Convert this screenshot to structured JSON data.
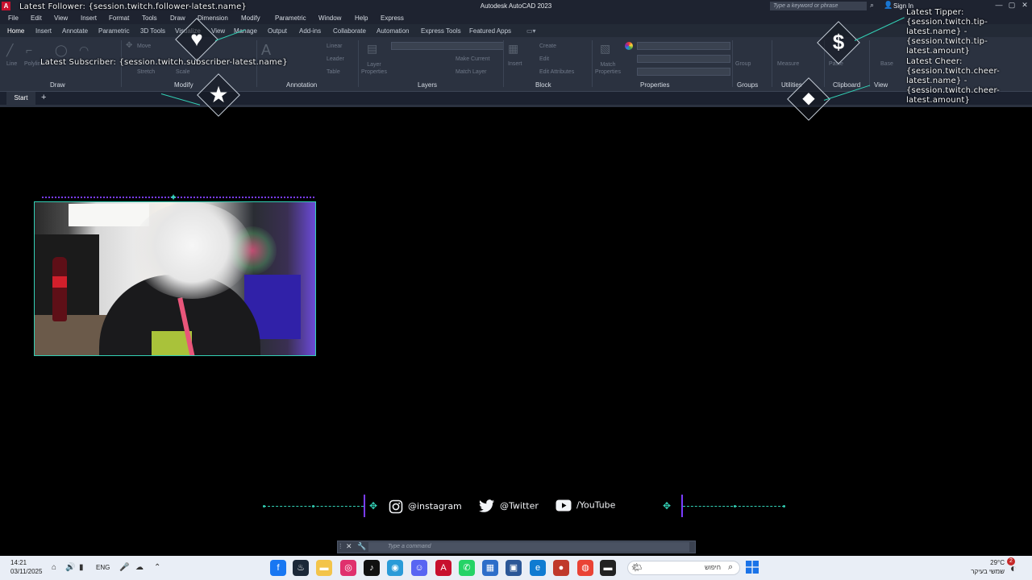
{
  "titlebar": {
    "app_title": "Autodesk AutoCAD 2023",
    "logo": "A",
    "search_placeholder": "Type a keyword or phrase",
    "sign_in": "Sign In"
  },
  "menu": [
    "File",
    "Edit",
    "View",
    "Insert",
    "Format",
    "Tools",
    "Draw",
    "Dimension",
    "Modify",
    "Parametric",
    "Window",
    "Help",
    "Express"
  ],
  "ribbon_tabs": [
    "Home",
    "Insert",
    "Annotate",
    "Parametric",
    "3D Tools",
    "Visualize",
    "View",
    "Manage",
    "Output",
    "Add-ins",
    "Collaborate",
    "Automation",
    "Express Tools",
    "Featured Apps"
  ],
  "ribbon": {
    "panels": [
      "Draw",
      "Modify",
      "Annotation",
      "Layers",
      "Block",
      "Properties",
      "Groups",
      "Utilities",
      "Clipboard",
      "View"
    ],
    "tools": {
      "line": "Line",
      "polyline": "Polyline",
      "move": "Move",
      "stretch": "Stretch",
      "scale": "Scale",
      "linear": "Linear",
      "leader": "Leader",
      "table": "Table",
      "layer_properties": "Layer Properties",
      "make_current": "Make Current",
      "match_layer": "Match Layer",
      "insert": "Insert",
      "create": "Create",
      "edit": "Edit",
      "edit_attributes": "Edit Attributes",
      "match_properties": "Match Properties",
      "group": "Group",
      "measure": "Measure",
      "paste": "Paste",
      "base": "Base"
    }
  },
  "file_tabs": {
    "start": "Start",
    "add": "+"
  },
  "overlay": {
    "latest_follower": "Latest Follower: {session.twitch.follower-latest.name}",
    "latest_subscriber": "Latest Subscriber: {session.twitch.subscriber-latest.name}",
    "latest_tipper": [
      "Latest Tipper:",
      "{session.twitch.tip-",
      "latest.name} -",
      "{session.twitch.tip-",
      "latest.amount}"
    ],
    "latest_cheer": [
      "Latest Cheer:",
      "{session.twitch.cheer-",
      "latest.name} -",
      "{session.twitch.cheer-",
      "latest.amount}"
    ],
    "socials": {
      "instagram": "@instagram",
      "twitter": "@Twitter",
      "youtube": "/YouTube"
    }
  },
  "command_line": {
    "placeholder": "Type a command"
  },
  "taskbar": {
    "time": "14:21",
    "date": "03/11/2025",
    "lang": "ENG",
    "search_label": "חיפוש",
    "weather_temp": "29°C",
    "weather_desc": "שמשי בעיקר",
    "badge": "2"
  },
  "colors": {
    "accent_teal": "#33d0b5",
    "accent_purple": "#7a3cff",
    "ribbon_bg": "#2b3240"
  }
}
